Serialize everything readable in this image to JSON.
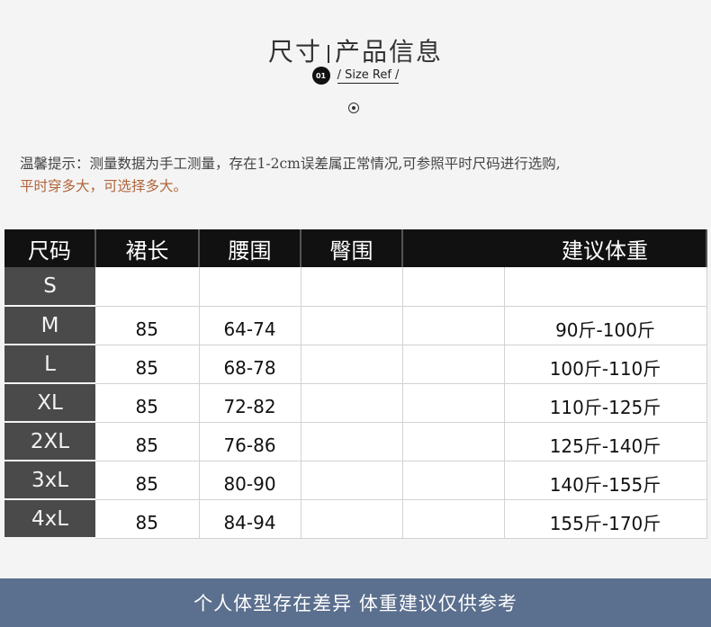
{
  "header": {
    "title_left": "尺寸",
    "title_right": "产品信息",
    "badge": "01",
    "subtitle": "/ Size Ref /"
  },
  "tip": {
    "line1": "温馨提示：测量数据为手工测量，存在1-2cm误差属正常情况,可参照平时尺码进行选购,",
    "line2": "平时穿多大，可选择多大。"
  },
  "table": {
    "headers": [
      "尺码",
      "裙长",
      "腰围",
      "臀围",
      "",
      "建议体重"
    ],
    "rows": [
      [
        "S",
        "",
        "",
        "",
        "",
        ""
      ],
      [
        "M",
        "85",
        "64-74",
        "",
        "",
        "90斤-100斤"
      ],
      [
        "L",
        "85",
        "68-78",
        "",
        "",
        "100斤-110斤"
      ],
      [
        "XL",
        "85",
        "72-82",
        "",
        "",
        "110斤-125斤"
      ],
      [
        "2XL",
        "85",
        "76-86",
        "",
        "",
        "125斤-140斤"
      ],
      [
        "3xL",
        "85",
        "80-90",
        "",
        "",
        "140斤-155斤"
      ],
      [
        "4xL",
        "85",
        "84-94",
        "",
        "",
        "155斤-170斤"
      ]
    ]
  },
  "footer": {
    "text": "个人体型存在差异  体重建议仅供参考"
  }
}
